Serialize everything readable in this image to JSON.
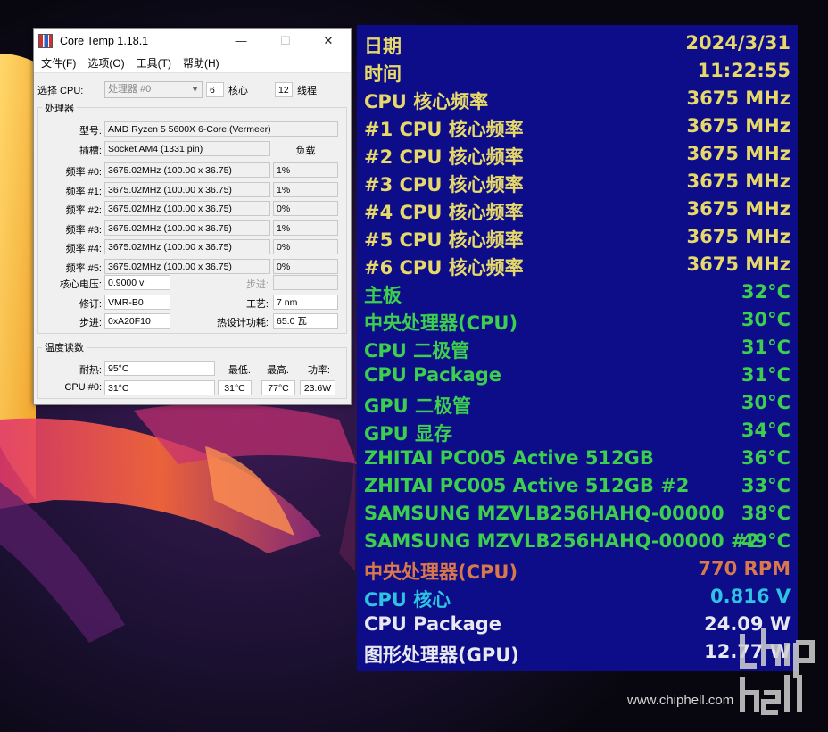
{
  "window": {
    "title": "Core Temp 1.18.1",
    "menus": [
      "文件(F)",
      "选项(O)",
      "工具(T)",
      "帮助(H)"
    ]
  },
  "select_row": {
    "cpu_label": "选择 CPU:",
    "cpu_value": "处理器 #0",
    "cores_value": "6",
    "cores_label": "核心",
    "threads_value": "12",
    "threads_label": "线程"
  },
  "processor": {
    "group_label": "处理器",
    "model_label": "型号:",
    "model_value": "AMD Ryzen 5 5600X 6-Core (Vermeer)",
    "socket_label": "插槽:",
    "socket_value": "Socket AM4 (1331 pin)",
    "load_header": "负载",
    "freqs": [
      {
        "label": "频率 #0:",
        "value": "3675.02MHz (100.00 x 36.75)",
        "load": "1%"
      },
      {
        "label": "频率 #1:",
        "value": "3675.02MHz (100.00 x 36.75)",
        "load": "1%"
      },
      {
        "label": "频率 #2:",
        "value": "3675.02MHz (100.00 x 36.75)",
        "load": "0%"
      },
      {
        "label": "频率 #3:",
        "value": "3675.02MHz (100.00 x 36.75)",
        "load": "1%"
      },
      {
        "label": "频率 #4:",
        "value": "3675.02MHz (100.00 x 36.75)",
        "load": "0%"
      },
      {
        "label": "频率 #5:",
        "value": "3675.02MHz (100.00 x 36.75)",
        "load": "0%"
      }
    ],
    "vcore_label": "核心电压:",
    "vcore_value": "0.9000 v",
    "stepping_label": "步进:",
    "stepping_value": "",
    "revision_label": "修订:",
    "revision_value": "VMR-B0",
    "process_label": "工艺:",
    "process_value": "7 nm",
    "cpuid_label": "步进:",
    "cpuid_value": "0xA20F10",
    "tdp_label": "热设计功耗:",
    "tdp_value": "65.0 瓦"
  },
  "temps": {
    "group_label": "温度读数",
    "tjmax_label": "耐热:",
    "tjmax_value": "95°C",
    "min_label": "最低.",
    "max_label": "最高.",
    "power_label": "功率:",
    "cpu0_label": "CPU #0:",
    "cpu0_value": "31°C",
    "cpu0_min": "31°C",
    "cpu0_max": "77°C",
    "cpu0_power": "23.6W"
  },
  "overlay": {
    "rows": [
      {
        "key": "日期",
        "value": "2024/3/31",
        "color": "#e6d96a"
      },
      {
        "key": "时间",
        "value": "11:22:55",
        "color": "#e6d96a"
      },
      {
        "key": "CPU 核心频率",
        "value": "3675 MHz",
        "color": "#e6d96a"
      },
      {
        "key": "#1 CPU 核心频率",
        "value": "3675 MHz",
        "color": "#e6d96a"
      },
      {
        "key": "#2 CPU 核心频率",
        "value": "3675 MHz",
        "color": "#e6d96a"
      },
      {
        "key": "#3 CPU 核心频率",
        "value": "3675 MHz",
        "color": "#e6d96a"
      },
      {
        "key": "#4 CPU 核心频率",
        "value": "3675 MHz",
        "color": "#e6d96a"
      },
      {
        "key": "#5 CPU 核心频率",
        "value": "3675 MHz",
        "color": "#e6d96a"
      },
      {
        "key": "#6 CPU 核心频率",
        "value": "3675 MHz",
        "color": "#e6d96a"
      },
      {
        "key": "主板",
        "value": "32°C",
        "color": "#3ccf4e"
      },
      {
        "key": "中央处理器(CPU)",
        "value": "30°C",
        "color": "#3ccf4e"
      },
      {
        "key": "CPU 二极管",
        "value": "31°C",
        "color": "#3ccf4e"
      },
      {
        "key": "CPU Package",
        "value": "31°C",
        "color": "#3ccf4e"
      },
      {
        "key": "GPU 二极管",
        "value": "30°C",
        "color": "#3ccf4e"
      },
      {
        "key": "GPU 显存",
        "value": "34°C",
        "color": "#3ccf4e"
      },
      {
        "key": "ZHITAI PC005 Active 512GB",
        "value": "36°C",
        "color": "#3ccf4e"
      },
      {
        "key": "ZHITAI PC005 Active 512GB #2",
        "value": "33°C",
        "color": "#3ccf4e"
      },
      {
        "key": "SAMSUNG MZVLB256HAHQ-00000",
        "value": "38°C",
        "color": "#3ccf4e"
      },
      {
        "key": "SAMSUNG MZVLB256HAHQ-00000 #2",
        "value": "49°C",
        "color": "#3ccf4e"
      },
      {
        "key": "中央处理器(CPU)",
        "value": "770 RPM",
        "color": "#d9784a"
      },
      {
        "key": "CPU 核心",
        "value": "0.816 V",
        "color": "#2ec3e0"
      },
      {
        "key": "CPU Package",
        "value": "24.09 W",
        "color": "#e8e8f0"
      },
      {
        "key": "图形处理器(GPU)",
        "value": "12.77 W",
        "color": "#e8e8f0"
      }
    ]
  },
  "watermark": {
    "url": "www.chiphell.com",
    "logo": "chip hell"
  }
}
